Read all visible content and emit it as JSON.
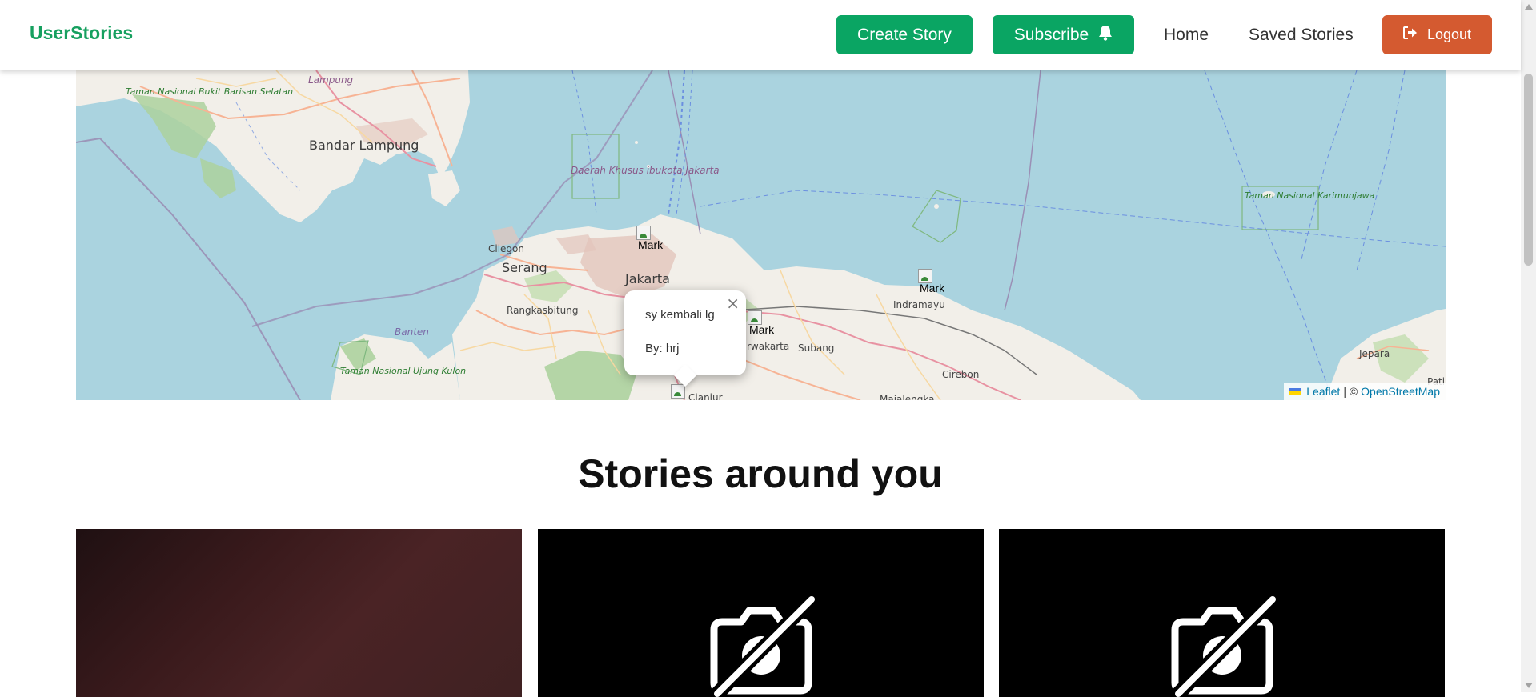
{
  "header": {
    "brand": "UserStories",
    "create_label": "Create Story",
    "subscribe_label": "Subscribe",
    "home_label": "Home",
    "saved_label": "Saved Stories",
    "logout_label": "Logout"
  },
  "map": {
    "labels": {
      "bandar_lampung": "Bandar Lampung",
      "lampung": "Lampung",
      "serang": "Serang",
      "jakarta": "Jakarta",
      "cilegon": "Cilegon",
      "rangkasbitung": "Rangkasbitung",
      "banten": "Banten",
      "indramayu": "Indramayu",
      "subang": "Subang",
      "purwakarta": "rwakarta",
      "cirebon": "Cirebon",
      "jepara": "Jepara",
      "pati": "Pati",
      "cianjur": "Cianjur",
      "majalengka": "Majalengka",
      "park_bukit": "Taman Nasional Bukit Barisan Selatan",
      "dki": "Daerah Khusus ibukota Jakarta",
      "park_karimun": "Taman Nasional Karimunjawa",
      "park_ujung": "Taman Nasional Ujung Kulon"
    },
    "marker_alt": "Mark",
    "popup": {
      "title": "sy kembali lg",
      "author": "By: hrj",
      "close": "×"
    },
    "attribution": {
      "leaflet": "Leaflet",
      "separator": "| ©",
      "osm": "OpenStreetMap"
    }
  },
  "stories": {
    "title": "Stories around you"
  },
  "colors": {
    "brand": "#16a05f",
    "primary_button": "#0aa563",
    "logout_button": "#d45a30",
    "sea": "#aad3df",
    "land": "#f2efe9"
  },
  "icons": {
    "subscribe": "bell-icon",
    "logout": "sign-out-icon",
    "card_placeholder": "camera-off-icon"
  }
}
